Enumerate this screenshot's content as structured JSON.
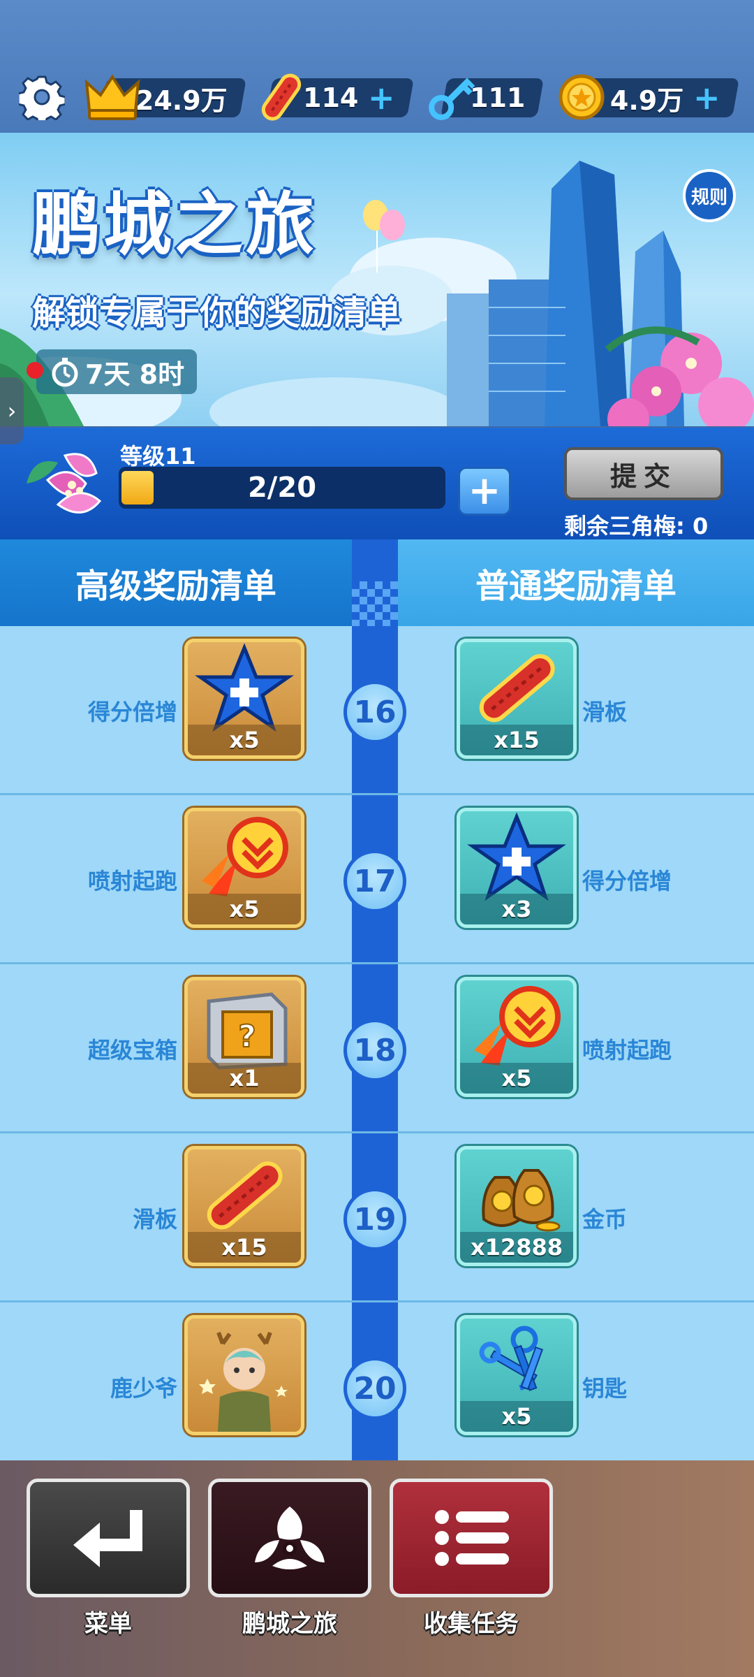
{
  "topbar": {
    "crown_value": "24.9万",
    "skateboard_value": "114",
    "key_value": "111",
    "coin_value": "4.9万",
    "plus": "+"
  },
  "banner": {
    "title": "鹏城之旅",
    "subtitle": "解锁专属于你的奖励清单",
    "rules": "规则",
    "timer": "7天 8时"
  },
  "level": {
    "label": "等级11",
    "progress_text": "2/20",
    "progress_fraction": 0.1,
    "plus": "+",
    "submit": "提交",
    "remaining": "剩余三角梅: 0"
  },
  "lists": {
    "premium_header": "高级奖励清单",
    "normal_header": "普通奖励清单",
    "rows": [
      {
        "level": "16",
        "premium": {
          "label": "得分倍增",
          "qty": "x5",
          "icon": "score-multiplier-star-icon"
        },
        "normal": {
          "label": "滑板",
          "qty": "x15",
          "icon": "skateboard-icon"
        }
      },
      {
        "level": "17",
        "premium": {
          "label": "喷射起跑",
          "qty": "x5",
          "icon": "jet-start-icon"
        },
        "normal": {
          "label": "得分倍增",
          "qty": "x3",
          "icon": "score-multiplier-star-icon"
        }
      },
      {
        "level": "18",
        "premium": {
          "label": "超级宝箱",
          "qty": "x1",
          "icon": "mystery-box-icon"
        },
        "normal": {
          "label": "喷射起跑",
          "qty": "x5",
          "icon": "jet-start-icon"
        }
      },
      {
        "level": "19",
        "premium": {
          "label": "滑板",
          "qty": "x15",
          "icon": "skateboard-icon"
        },
        "normal": {
          "label": "金币",
          "qty": "x12888",
          "icon": "coin-bags-icon"
        }
      },
      {
        "level": "20",
        "premium": {
          "label": "鹿少爷",
          "qty": "",
          "icon": "character-deer-icon"
        },
        "normal": {
          "label": "钥匙",
          "qty": "x5",
          "icon": "keys-icon"
        }
      }
    ]
  },
  "nav": {
    "menu": "菜单",
    "journey": "鹏城之旅",
    "tasks": "收集任务"
  },
  "colors": {
    "premium_card": "#d19a45",
    "normal_card": "#4fc2c2",
    "road": "#1e63d6",
    "accent_blue": "#1a62c4"
  }
}
